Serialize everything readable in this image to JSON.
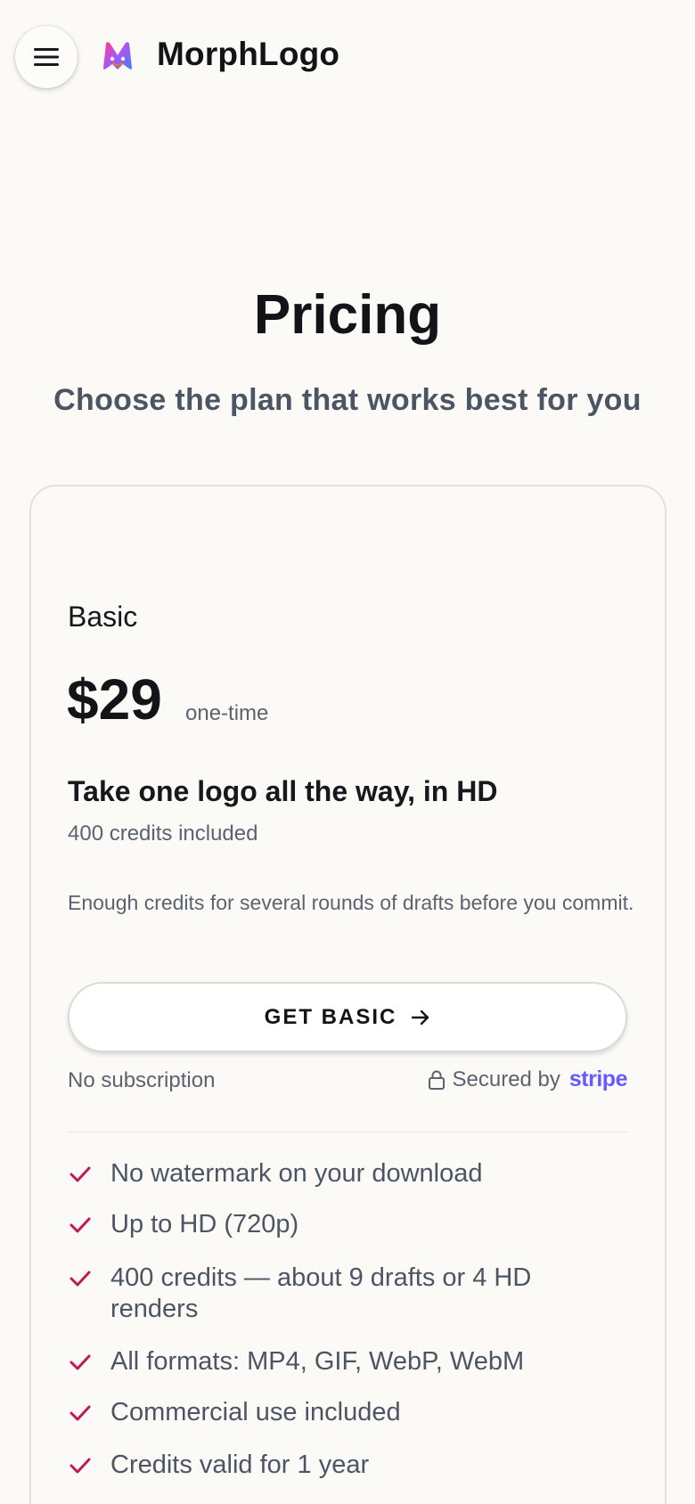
{
  "header": {
    "brand_name": "MorphLogo",
    "menu_icon": "hamburger-menu-icon",
    "logo_colors": [
      "#ff4fa0",
      "#8b5cf6",
      "#3b82f6",
      "#f97316"
    ]
  },
  "hero": {
    "title": "Pricing",
    "subtitle": "Choose the plan that works best for you"
  },
  "plan": {
    "name": "Basic",
    "price": "$29",
    "price_term": "one-time",
    "headline": "Take one logo all the way, in HD",
    "credits_included": "400 credits included",
    "description": "Enough credits for several rounds of drafts before you commit.",
    "cta_label": "GET BASIC",
    "no_subscription": "No subscription",
    "secured_by": "Secured by",
    "payment_provider": "stripe",
    "features": [
      "No watermark on your download",
      "Up to HD (720p)",
      "400 credits — about 9 drafts or 4 HD renders",
      "All formats: MP4, GIF, WebP, WebM",
      "Commercial use included",
      "Credits valid for 1 year"
    ]
  },
  "colors": {
    "background": "#fcfaf6",
    "check_accent": "#c2185b",
    "stripe_brand": "#635bff",
    "muted_text": "#5b6370"
  }
}
